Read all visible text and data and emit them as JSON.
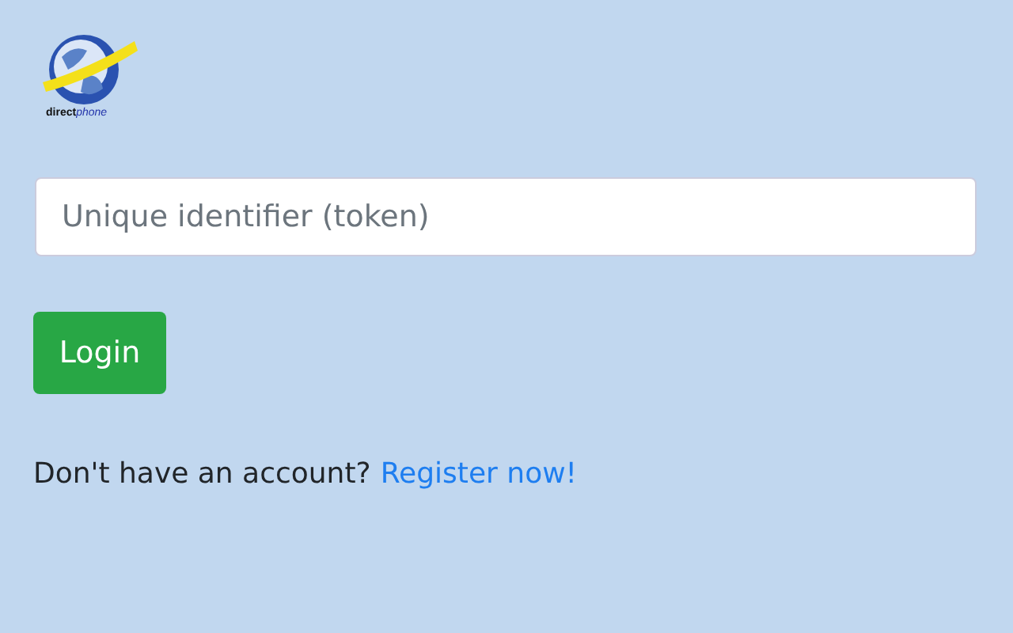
{
  "logo": {
    "text_plain": "direct",
    "text_accent": "phone"
  },
  "token_field": {
    "placeholder": "Unique identifier (token)"
  },
  "login_button": {
    "label": "Login"
  },
  "register": {
    "prompt": "Don't have an account?",
    "link": "Register now!"
  }
}
